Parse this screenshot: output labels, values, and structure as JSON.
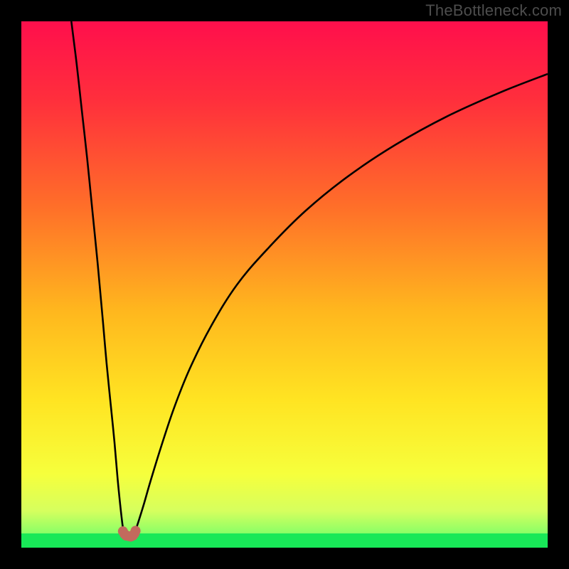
{
  "watermark": "TheBottleneck.com",
  "colors": {
    "frame": "#000000",
    "watermark": "#4d4d4d",
    "curve": "#000000",
    "marker": "#c26a5d",
    "bottom_band": "#18e858",
    "gradient_stops": [
      {
        "offset": 0.0,
        "color": "#ff0f4c"
      },
      {
        "offset": 0.15,
        "color": "#ff2f3c"
      },
      {
        "offset": 0.35,
        "color": "#ff6e29"
      },
      {
        "offset": 0.55,
        "color": "#ffb71e"
      },
      {
        "offset": 0.72,
        "color": "#ffe422"
      },
      {
        "offset": 0.86,
        "color": "#f6ff3c"
      },
      {
        "offset": 0.93,
        "color": "#d6ff5e"
      },
      {
        "offset": 0.97,
        "color": "#8fff66"
      },
      {
        "offset": 1.0,
        "color": "#18e858"
      }
    ]
  },
  "chart_data": {
    "type": "line",
    "title": "",
    "xlabel": "",
    "ylabel": "",
    "xlim": [
      0,
      100
    ],
    "ylim": [
      0,
      100
    ],
    "series": [
      {
        "name": "left-branch",
        "x": [
          9.5,
          10.5,
          11.5,
          12.5,
          13.5,
          14.5,
          15.5,
          16.2,
          17.0,
          17.7,
          18.3,
          18.8,
          19.2,
          19.5
        ],
        "y": [
          100,
          92,
          83,
          74,
          64,
          54,
          43,
          35,
          27,
          20,
          13,
          8,
          4.5,
          2.5
        ]
      },
      {
        "name": "right-branch",
        "x": [
          21.5,
          22.2,
          23.2,
          24.5,
          26.5,
          29.0,
          32.0,
          36.0,
          41.0,
          47.0,
          54.0,
          62.0,
          71.0,
          81.0,
          91.0,
          100.0
        ],
        "y": [
          2.7,
          4.8,
          8.0,
          12.5,
          19.0,
          26.5,
          34.0,
          42.0,
          50.0,
          57.0,
          64.0,
          70.5,
          76.5,
          82.0,
          86.5,
          90.0
        ]
      }
    ],
    "valley_markers": {
      "name": "valley",
      "points": [
        {
          "x": 19.3,
          "y": 3.1
        },
        {
          "x": 19.6,
          "y": 2.6
        },
        {
          "x": 19.9,
          "y": 2.3
        },
        {
          "x": 20.4,
          "y": 2.2
        },
        {
          "x": 20.8,
          "y": 2.1
        },
        {
          "x": 21.2,
          "y": 2.3
        },
        {
          "x": 21.5,
          "y": 2.7
        },
        {
          "x": 21.7,
          "y": 3.2
        }
      ]
    }
  }
}
